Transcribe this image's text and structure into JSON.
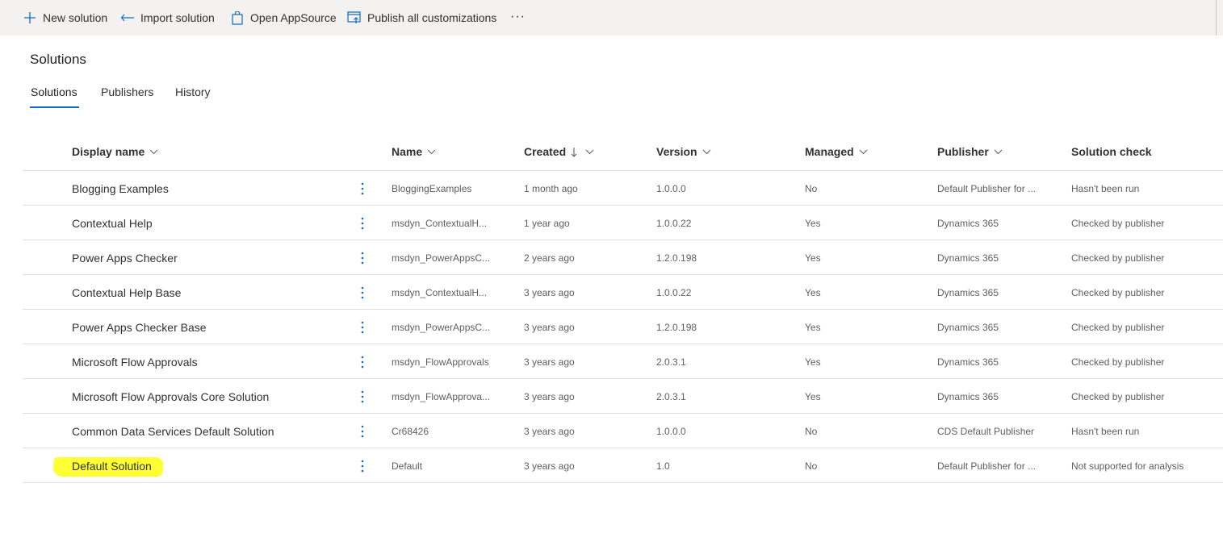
{
  "commandbar": {
    "new_solution": "New solution",
    "import_solution": "Import solution",
    "open_appsource": "Open AppSource",
    "publish_all": "Publish all customizations",
    "more": "···"
  },
  "page": {
    "title": "Solutions"
  },
  "tabs": [
    {
      "label": "Solutions",
      "active": true
    },
    {
      "label": "Publishers",
      "active": false
    },
    {
      "label": "History",
      "active": false
    }
  ],
  "columns": {
    "display_name": "Display name",
    "name": "Name",
    "created": "Created",
    "version": "Version",
    "managed": "Managed",
    "publisher": "Publisher",
    "solution_check": "Solution check"
  },
  "rows": [
    {
      "display": "Blogging Examples",
      "name": "BloggingExamples",
      "created": "1 month ago",
      "version": "1.0.0.0",
      "managed": "No",
      "publisher": "Default Publisher for ...",
      "check": "Hasn't been run"
    },
    {
      "display": "Contextual Help",
      "name": "msdyn_ContextualH...",
      "created": "1 year ago",
      "version": "1.0.0.22",
      "managed": "Yes",
      "publisher": "Dynamics 365",
      "check": "Checked by publisher"
    },
    {
      "display": "Power Apps Checker",
      "name": "msdyn_PowerAppsC...",
      "created": "2 years ago",
      "version": "1.2.0.198",
      "managed": "Yes",
      "publisher": "Dynamics 365",
      "check": "Checked by publisher"
    },
    {
      "display": "Contextual Help Base",
      "name": "msdyn_ContextualH...",
      "created": "3 years ago",
      "version": "1.0.0.22",
      "managed": "Yes",
      "publisher": "Dynamics 365",
      "check": "Checked by publisher"
    },
    {
      "display": "Power Apps Checker Base",
      "name": "msdyn_PowerAppsC...",
      "created": "3 years ago",
      "version": "1.2.0.198",
      "managed": "Yes",
      "publisher": "Dynamics 365",
      "check": "Checked by publisher"
    },
    {
      "display": "Microsoft Flow Approvals",
      "name": "msdyn_FlowApprovals",
      "created": "3 years ago",
      "version": "2.0.3.1",
      "managed": "Yes",
      "publisher": "Dynamics 365",
      "check": "Checked by publisher"
    },
    {
      "display": "Microsoft Flow Approvals Core Solution",
      "name": "msdyn_FlowApprova...",
      "created": "3 years ago",
      "version": "2.0.3.1",
      "managed": "Yes",
      "publisher": "Dynamics 365",
      "check": "Checked by publisher"
    },
    {
      "display": "Common Data Services Default Solution",
      "name": "Cr68426",
      "created": "3 years ago",
      "version": "1.0.0.0",
      "managed": "No",
      "publisher": "CDS Default Publisher",
      "check": "Hasn't been run"
    },
    {
      "display": "Default Solution",
      "name": "Default",
      "created": "3 years ago",
      "version": "1.0",
      "managed": "No",
      "publisher": "Default Publisher for ...",
      "check": "Not supported for analysis",
      "highlighted": true
    }
  ],
  "colors": {
    "accent": "#0f6cbd",
    "highlight": "#ffff33",
    "commandbar_bg": "#f3f2f1"
  }
}
